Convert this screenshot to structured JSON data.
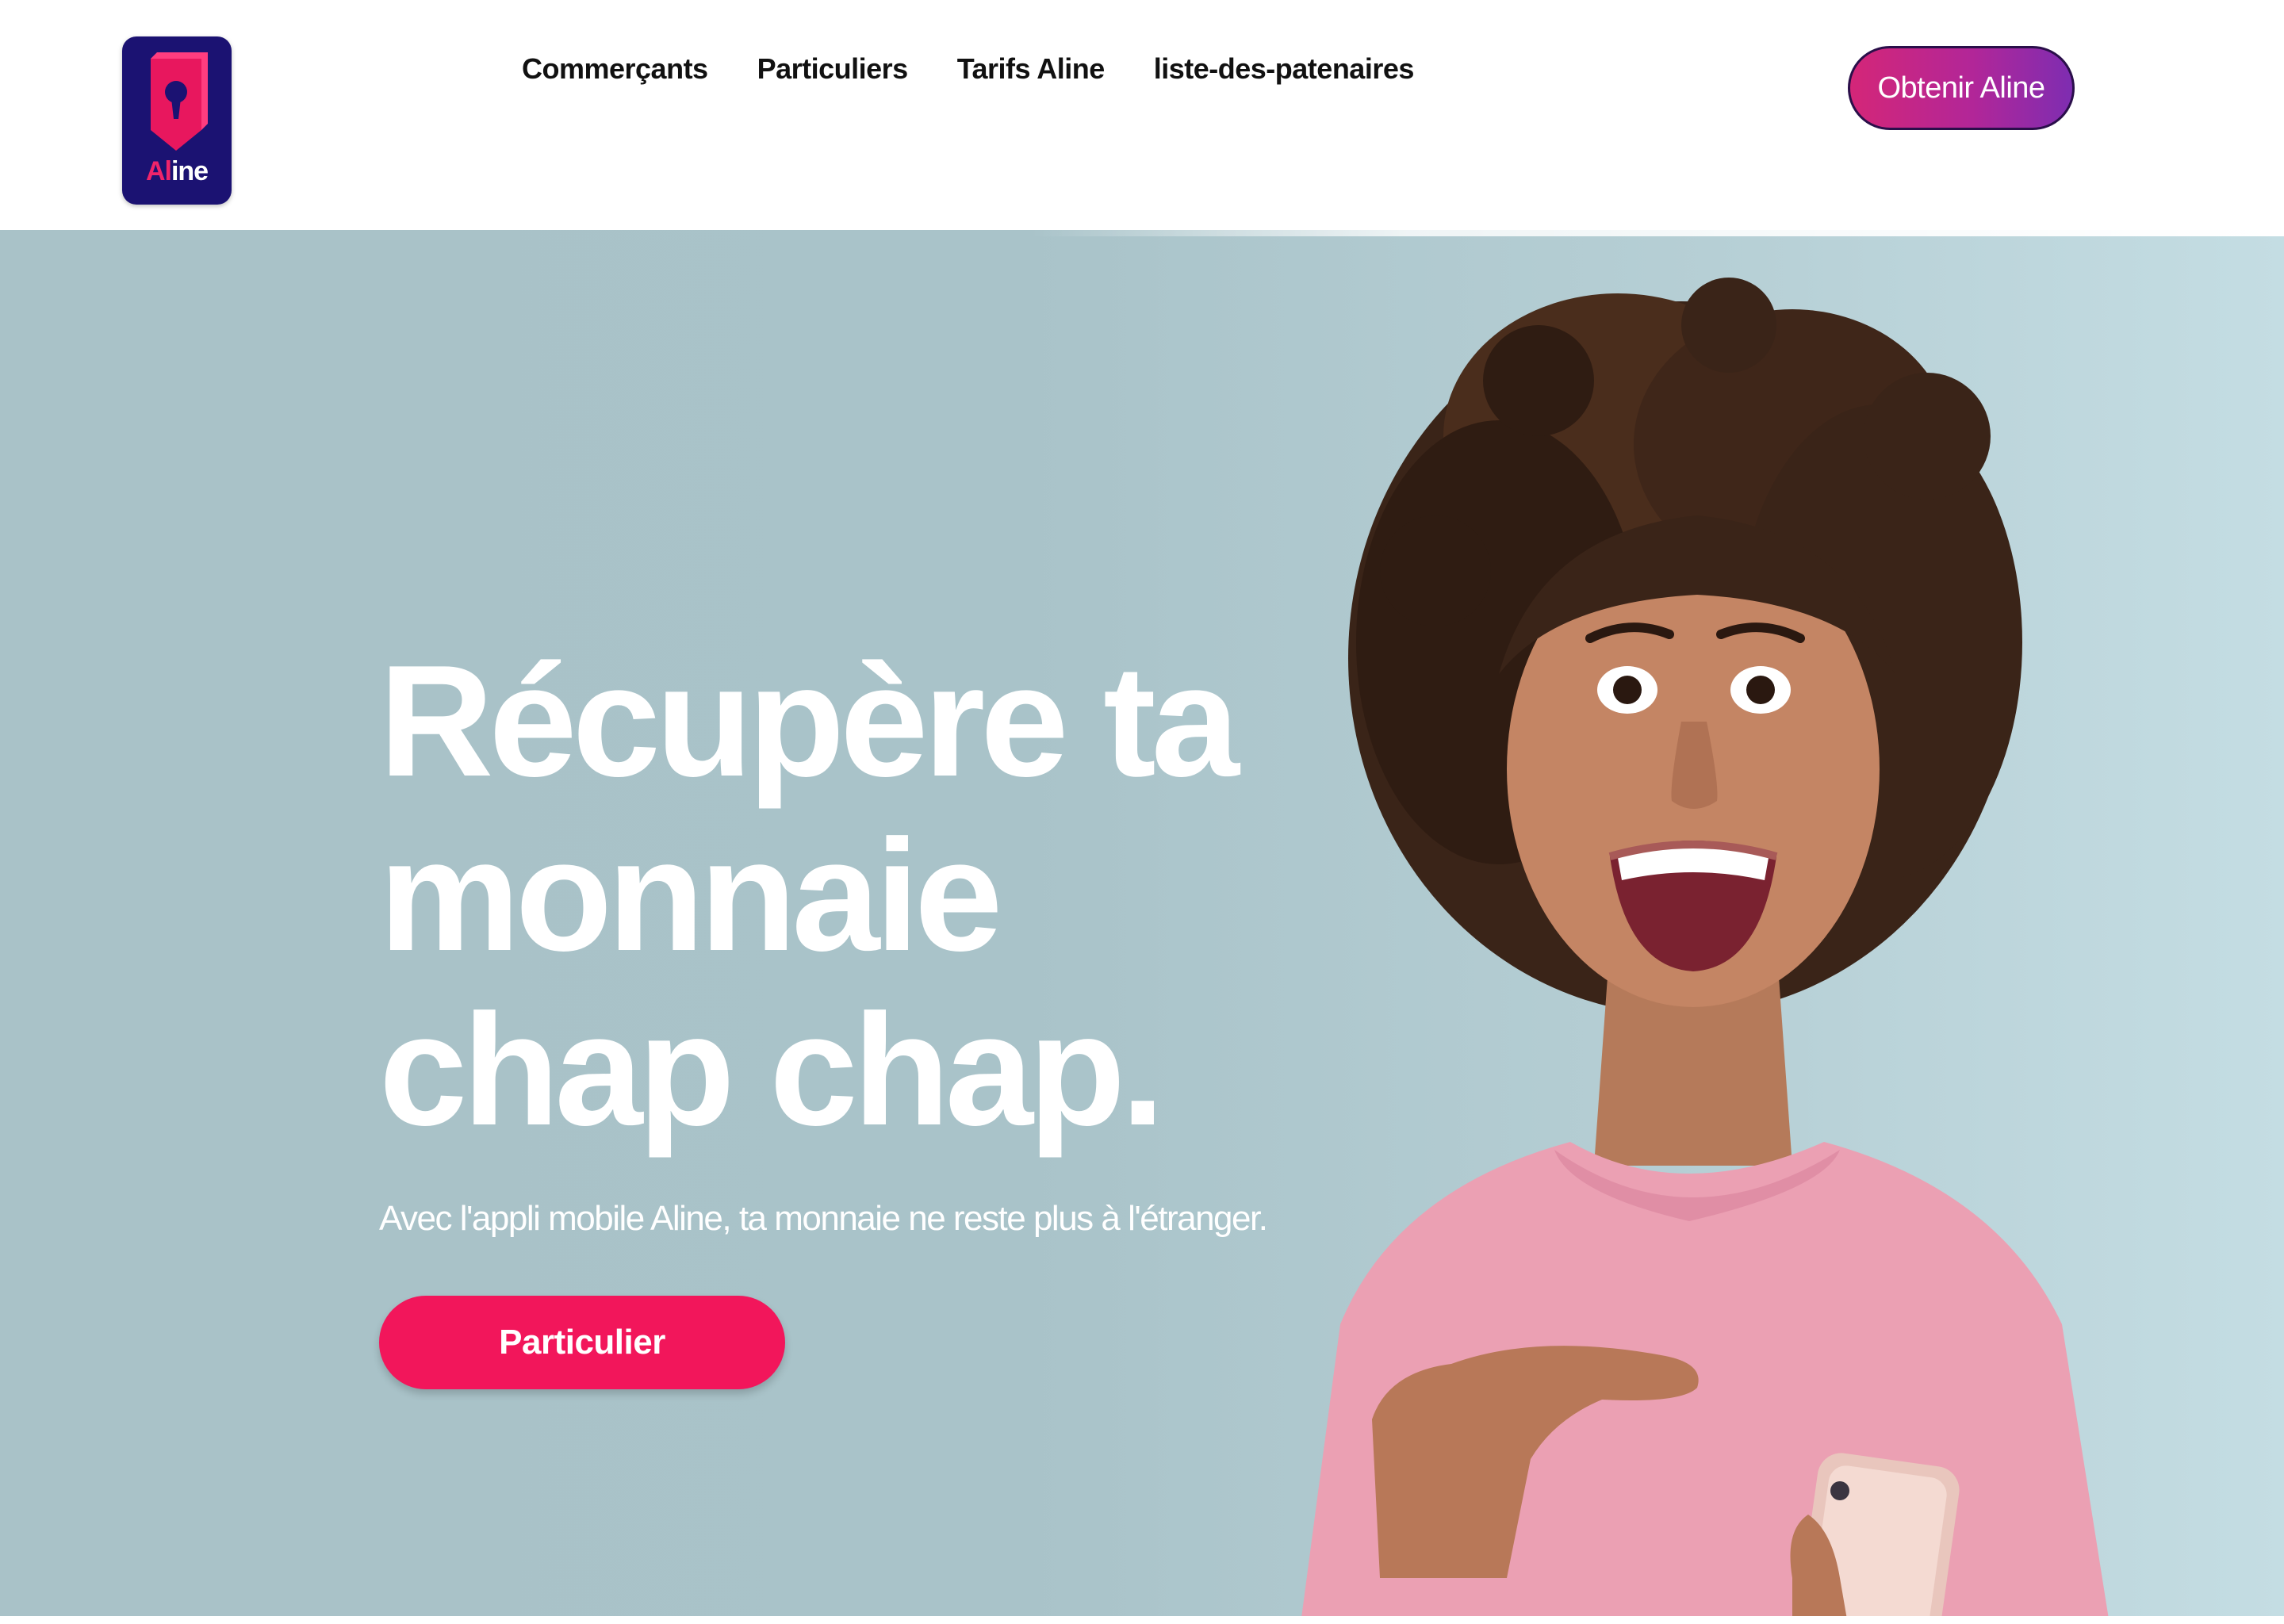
{
  "brand": {
    "logo_text_accent": "Al",
    "logo_text_rest": "ine"
  },
  "nav": {
    "items": [
      {
        "label": "Commerçants"
      },
      {
        "label": "Particuliers"
      },
      {
        "label": "Tarifs Aline"
      },
      {
        "label": "liste-des-patenaires"
      }
    ],
    "cta_label": "Obtenir Aline"
  },
  "hero": {
    "headline_lines": [
      "Récupère ta",
      "monnaie",
      "chap chap."
    ],
    "subtitle": "Avec l'appli mobile Aline, ta monnaie ne reste plus à l'étranger.",
    "cta_label": "Particulier"
  },
  "colors": {
    "logo_bg": "#1b1272",
    "accent_pink": "#f2165b",
    "cta_gradient_start": "#d42678",
    "cta_gradient_end": "#7e2db1",
    "hero_bg": "#a9c2c8",
    "sweater": "#eba0b3"
  },
  "icons": {
    "logo": "book-keyhole-icon"
  }
}
